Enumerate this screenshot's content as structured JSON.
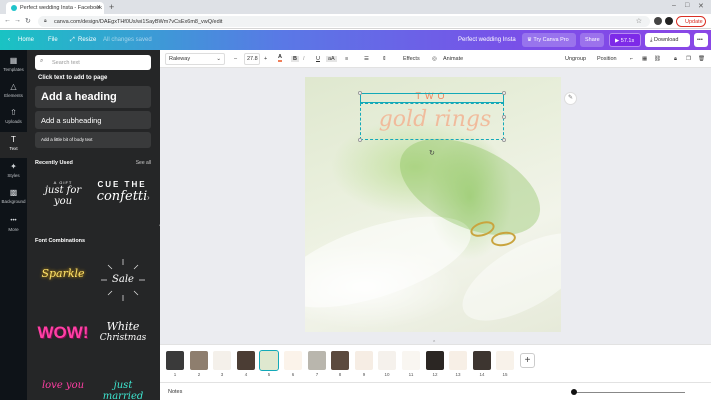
{
  "browser": {
    "tab_title": "Perfect wedding Insta - Facebook",
    "new_tab": "+",
    "url": "canva.com/design/DAEgxTHf0Us/wi1SayBWm7vCsEx6m8_vwQ/edit",
    "update_label": "Update"
  },
  "topbar": {
    "home": "Home",
    "file": "File",
    "resize": "Resize",
    "saved": "All changes saved",
    "title": "Perfect wedding Insta",
    "try_pro": "Try Canva Pro",
    "share": "Share",
    "time": "57.1s",
    "download": "Download",
    "more": "•••"
  },
  "rail": [
    {
      "icon": "▦",
      "label": "Templates",
      "name": "templates"
    },
    {
      "icon": "△",
      "label": "Elements",
      "name": "elements"
    },
    {
      "icon": "⇧",
      "label": "Uploads",
      "name": "uploads"
    },
    {
      "icon": "T",
      "label": "Text",
      "name": "text"
    },
    {
      "icon": "✦",
      "label": "Styles",
      "name": "styles"
    },
    {
      "icon": "▩",
      "label": "Background",
      "name": "background"
    },
    {
      "icon": "•••",
      "label": "More",
      "name": "more"
    }
  ],
  "panel": {
    "search_placeholder": "Search text",
    "click_text": "Click text to add to page",
    "add_heading": "Add a heading",
    "add_subheading": "Add a subheading",
    "add_body": "Add a little bit of body text",
    "recently_used": "Recently Used",
    "see_all": "See all",
    "recent_1_top": "A GIFT",
    "recent_1_main": "just for you",
    "recent_2_top": "CUE THE",
    "recent_2_main": "confetti",
    "font_combinations": "Font Combinations",
    "combo_1": "Sparkle",
    "combo_2_main": "Sale",
    "combo_3": "WOW!",
    "combo_4_main": "White",
    "combo_4_sub": "Christmas",
    "combo_5": "love you",
    "combo_6": "just married"
  },
  "toolbar": {
    "font": "Raleway",
    "minus": "–",
    "size": "27.8",
    "plus": "+",
    "effects": "Effects",
    "animate": "Animate",
    "ungroup": "Ungroup",
    "position": "Position"
  },
  "design": {
    "line1": "TWO",
    "line2": "gold rings"
  },
  "pages": [
    "1",
    "2",
    "3",
    "4",
    "5",
    "6",
    "7",
    "8",
    "9",
    "10",
    "11",
    "12",
    "13",
    "14",
    "15"
  ],
  "notes": "Notes",
  "colors": {
    "accent_teal": "#19c3c3",
    "accent_purple": "#7d2ae8",
    "text_coral": "#f07f5a",
    "text_peach": "#f2b696"
  }
}
